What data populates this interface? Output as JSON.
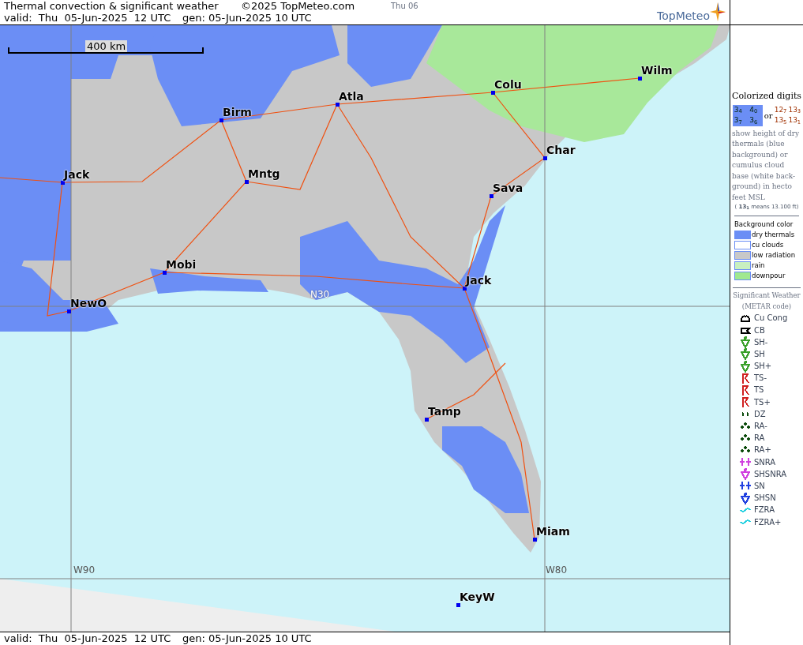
{
  "header": {
    "title": "Thermal convection & significant weather",
    "copyright": "©2025 TopMeteo.com",
    "next_day": "Thu 06",
    "valid": "valid:  Thu  05-Jun-2025  12 UTC",
    "generated": "gen: 05-Jun-2025 10 UTC",
    "logo": "TopMeteo"
  },
  "map": {
    "scale": "400 km",
    "cities": [
      {
        "name": "Atla"
      },
      {
        "name": "Birm"
      },
      {
        "name": "Jack"
      },
      {
        "name": "Mntg"
      },
      {
        "name": "Mobi"
      },
      {
        "name": "NewO"
      },
      {
        "name": "Colu"
      },
      {
        "name": "Wilm"
      },
      {
        "name": "Char"
      },
      {
        "name": "Sava"
      },
      {
        "name": "Jack"
      },
      {
        "name": "Tamp"
      },
      {
        "name": "Miam"
      },
      {
        "name": "KeyW"
      }
    ],
    "grid_labels": [
      {
        "text": "N30"
      },
      {
        "text": "W90"
      },
      {
        "text": "W80"
      }
    ]
  },
  "legend": {
    "digits_title": "Colorized digits",
    "blue_digits": [
      "3$_{4}$",
      "4$_{0}$",
      "3$_{7}$",
      "3$_{6}$"
    ],
    "or": "or",
    "cloud_digits": [
      "12$_{7}$",
      "13$_{3}$",
      "13$_{5}$",
      "13$_{1}$"
    ],
    "description": "show height of dry thermals (blue background) or cumulus cloud base (white back-ground) in hecto feet MSL",
    "example": "( **13$_{1}$** means 13.100 ft)",
    "background_title": "Background color",
    "backgrounds": [
      {
        "label": "dry thermals",
        "color": "#6b8ef5"
      },
      {
        "label": "cu clouds",
        "color": "#ffffff"
      },
      {
        "label": "low radiation",
        "color": "#c8c8c8"
      },
      {
        "label": "rain",
        "color": "#c8f0c0"
      },
      {
        "label": "downpour",
        "color": "#a0e890"
      }
    ],
    "weather_title": "Significant Weather (METAR code)",
    "weather": [
      {
        "label": "Cu Cong",
        "kind": "cucong",
        "color": "#000000"
      },
      {
        "label": "CB",
        "kind": "cb",
        "color": "#000000"
      },
      {
        "label": "SH-",
        "kind": "shower",
        "color": "#3aa02a"
      },
      {
        "label": "SH",
        "kind": "shower",
        "color": "#3aa02a"
      },
      {
        "label": "SH+",
        "kind": "shower",
        "color": "#3aa02a"
      },
      {
        "label": "TS-",
        "kind": "thunder",
        "color": "#d02020"
      },
      {
        "label": "TS",
        "kind": "thunder",
        "color": "#d02020"
      },
      {
        "label": "TS+",
        "kind": "thunder",
        "color": "#d02020"
      },
      {
        "label": "DZ",
        "kind": "drizzle",
        "color": "#0a4a0a"
      },
      {
        "label": "RA-",
        "kind": "dots",
        "color": "#0a4a0a"
      },
      {
        "label": "RA",
        "kind": "dots",
        "color": "#0a4a0a"
      },
      {
        "label": "RA+",
        "kind": "dots",
        "color": "#0a4a0a"
      },
      {
        "label": "SNRA",
        "kind": "snow",
        "color": "#d040e0"
      },
      {
        "label": "SHSNRA",
        "kind": "shower",
        "color": "#d040e0"
      },
      {
        "label": "SN",
        "kind": "snow",
        "color": "#2040e0"
      },
      {
        "label": "SHSN",
        "kind": "shower",
        "color": "#2040e0"
      },
      {
        "label": "FZRA",
        "kind": "freezing",
        "color": "#20d0e0"
      },
      {
        "label": "FZRA+",
        "kind": "freezing",
        "color": "#20d0e0"
      }
    ]
  },
  "footer": {
    "valid": "valid:  Thu  05-Jun-2025  12 UTC",
    "generated": "gen: 05-Jun-2025 10 UTC"
  }
}
